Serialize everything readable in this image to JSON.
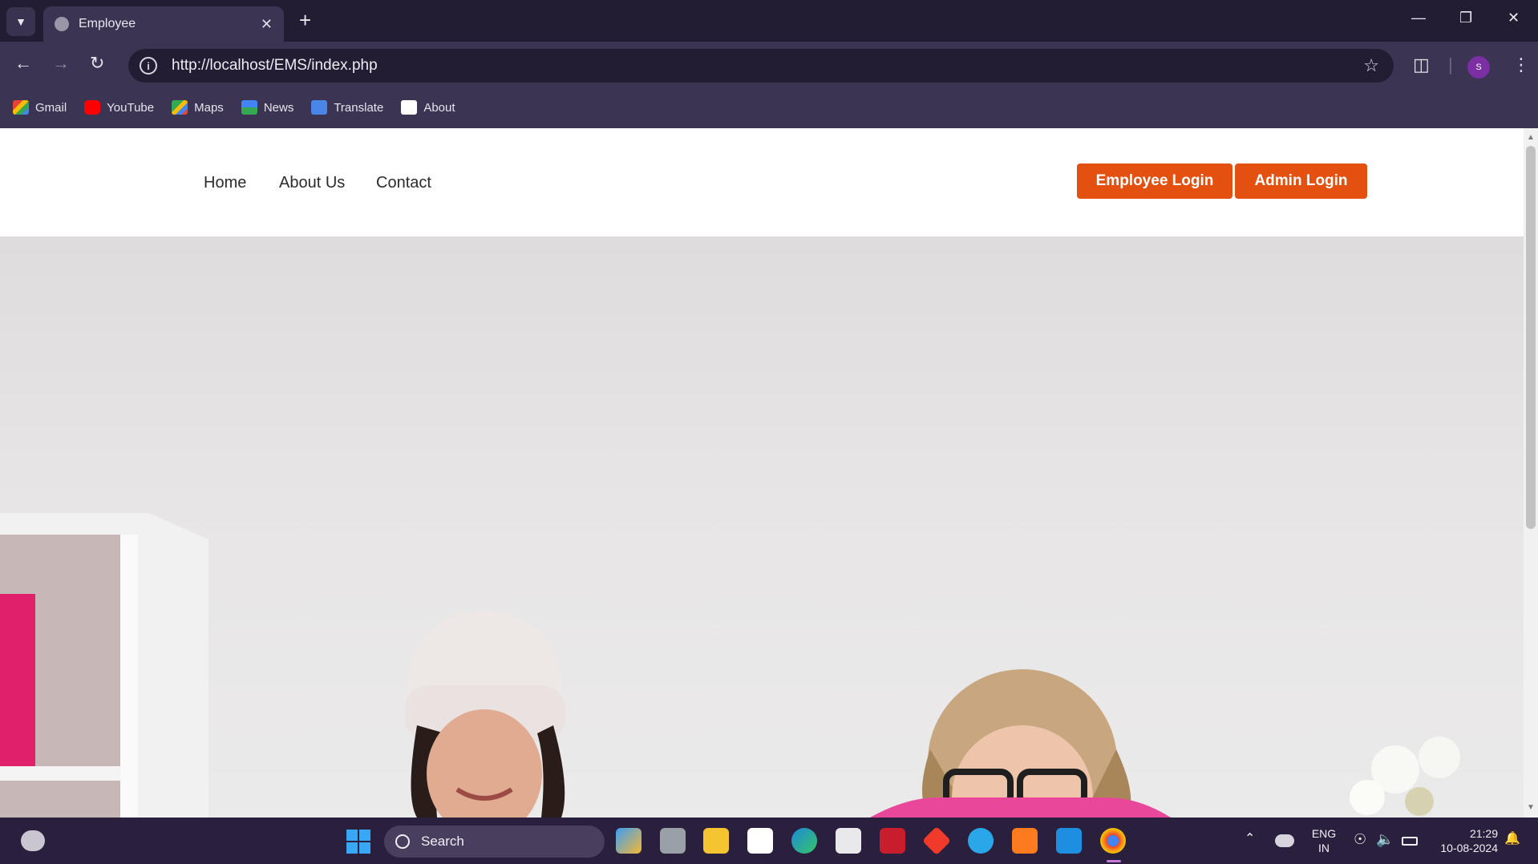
{
  "browser": {
    "tab_title": "Employee",
    "url": "http://localhost/EMS/index.php",
    "profile_initial": "S",
    "bookmarks": [
      {
        "label": "Gmail"
      },
      {
        "label": "YouTube"
      },
      {
        "label": "Maps"
      },
      {
        "label": "News"
      },
      {
        "label": "Translate"
      },
      {
        "label": "About"
      }
    ]
  },
  "site": {
    "nav": {
      "home": "Home",
      "about": "About Us",
      "contact": "Contact"
    },
    "buttons": {
      "employee_login": "Employee Login",
      "admin_login": "Admin Login"
    },
    "accent_color": "#e4500f"
  },
  "taskbar": {
    "search_placeholder": "Search",
    "language": "ENG",
    "region": "IN",
    "time": "21:29",
    "date": "10-08-2024"
  }
}
